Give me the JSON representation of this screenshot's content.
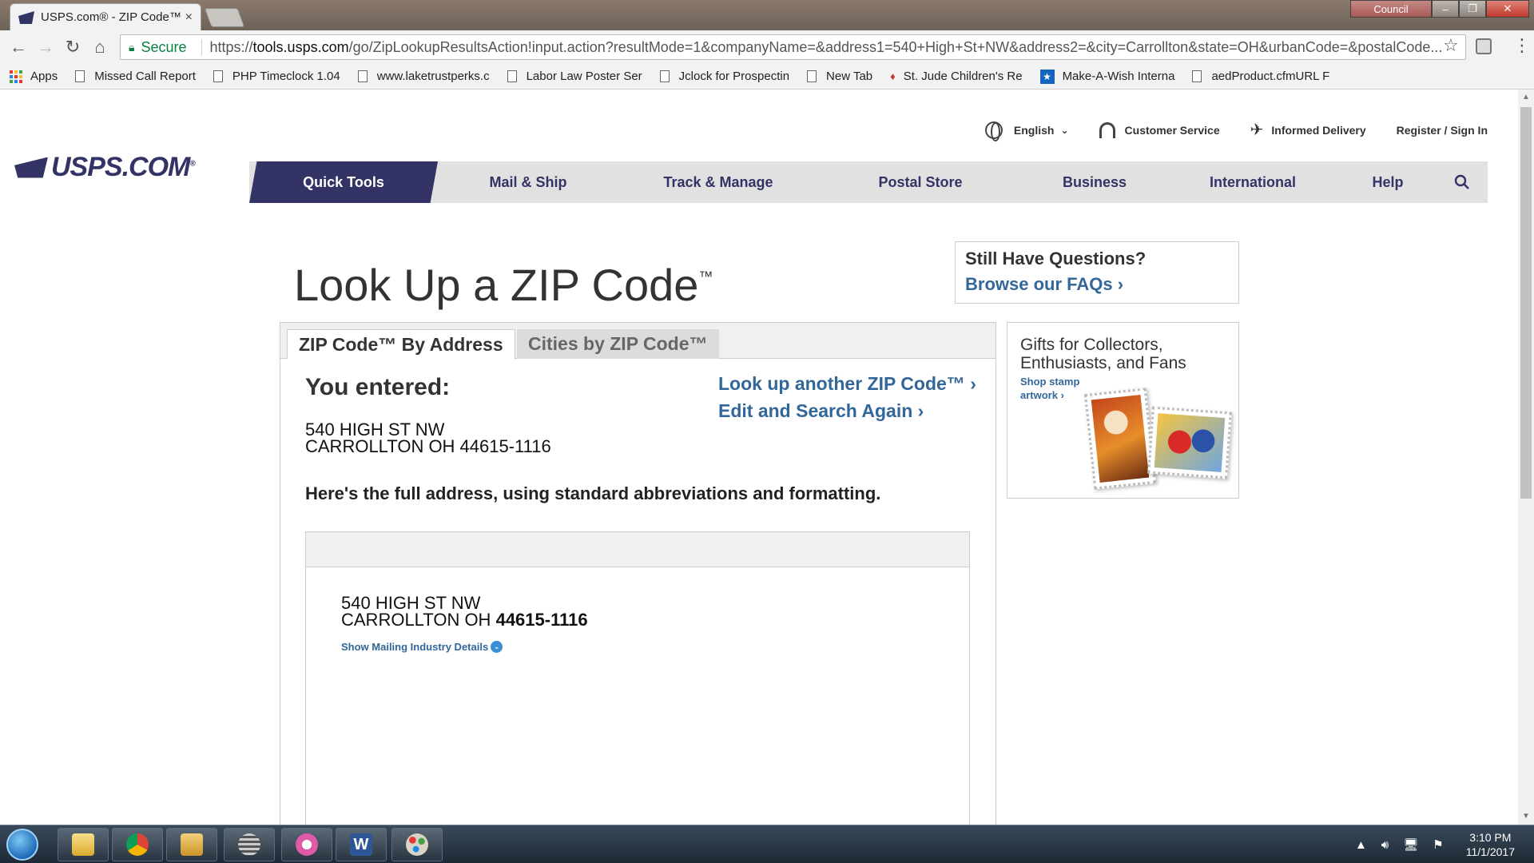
{
  "browser": {
    "tab_title": "USPS.com® - ZIP Code™",
    "tab_close": "×",
    "window_extra_label": "Council",
    "secure_label": "Secure",
    "url_scheme": "https://",
    "url_host": "tools.usps.com",
    "url_path": "/go/ZipLookupResultsAction!input.action?resultMode=1&companyName=&address1=540+High+St+NW&address2=&city=Carrollton&state=OH&urbanCode=&postalCode...",
    "bookmarks": [
      {
        "label": "Apps",
        "icon": "apps-grid-icon"
      },
      {
        "label": "Missed Call Report",
        "icon": "page-icon"
      },
      {
        "label": "PHP Timeclock 1.04",
        "icon": "page-icon"
      },
      {
        "label": "www.laketrustperks.c",
        "icon": "page-icon"
      },
      {
        "label": "Labor Law Poster Ser",
        "icon": "page-icon"
      },
      {
        "label": "Jclock for Prospectin",
        "icon": "page-icon"
      },
      {
        "label": "New Tab",
        "icon": "page-icon"
      },
      {
        "label": "St. Jude Children's Re",
        "icon": "stjude-icon"
      },
      {
        "label": "Make-A-Wish Interna",
        "icon": "star-icon"
      },
      {
        "label": "aedProduct.cfmURL F",
        "icon": "page-icon"
      }
    ]
  },
  "header": {
    "language": "English",
    "customer_service": "Customer  Service",
    "informed_delivery": "Informed Delivery",
    "register": "Register / Sign In",
    "logo_text": "USPS.COM",
    "logo_mark": "®",
    "nav": [
      "Quick Tools",
      "Mail & Ship",
      "Track & Manage",
      "Postal Store",
      "Business",
      "International",
      "Help"
    ]
  },
  "page": {
    "title": "Look Up a ZIP Code",
    "title_tm": "™",
    "faq_question": "Still Have Questions?",
    "faq_link": "Browse our FAQs ›",
    "tabs": [
      "ZIP Code™ By Address",
      "Cities by ZIP Code™"
    ],
    "you_entered_label": "You entered:",
    "entered_line1": "540 HIGH ST NW",
    "entered_line2": "CARROLLTON OH 44615-1116",
    "link_lookup_another": "Look up another ZIP Code™ ›",
    "link_edit_search": "Edit and Search Again ›",
    "explain_text": "Here's the full address, using standard abbreviations and formatting.",
    "result_line1": "540 HIGH ST NW",
    "result_city_state": "CARROLLTON OH",
    "result_zip": "44615-1116",
    "details_link": "Show Mailing Industry Details",
    "promo_title": "Gifts for Collectors, Enthusiasts, and Fans",
    "promo_link": "Shop stamp artwork ›"
  },
  "taskbar": {
    "apps": [
      "file-explorer-icon",
      "chrome-icon",
      "folder-users-icon",
      "network-icon",
      "itunes-icon",
      "word-icon",
      "paint-icon"
    ],
    "time": "3:10 PM",
    "date": "11/1/2017"
  },
  "colors": {
    "usps_navy": "#333366",
    "link_blue": "#336699",
    "nav_gray": "#e1e1e1"
  }
}
